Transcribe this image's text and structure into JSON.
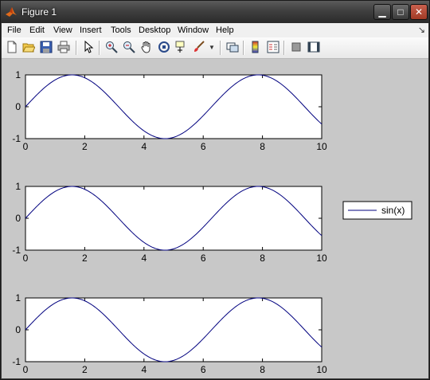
{
  "window": {
    "title": "Figure 1",
    "minimize": "▁",
    "maximize": "□",
    "close": "✕"
  },
  "menu": {
    "items": [
      "File",
      "Edit",
      "View",
      "Insert",
      "Tools",
      "Desktop",
      "Window",
      "Help"
    ],
    "arrow": "↘"
  },
  "toolbar": {
    "icons": [
      "new-figure-icon",
      "open-file-icon",
      "save-icon",
      "print-icon",
      "edit-plot-arrow-icon",
      "zoom-in-icon",
      "zoom-out-icon",
      "pan-hand-icon",
      "rotate-3d-icon",
      "data-cursor-icon",
      "brush-icon",
      "brush-dropdown-icon",
      "link-plot-icon",
      "insert-colorbar-icon",
      "insert-legend-icon",
      "hide-plot-tools-icon",
      "show-plot-tools-icon"
    ]
  },
  "colors": {
    "line": "#00007f",
    "axes_bg": "#ffffff",
    "figure_bg": "#c8c8c8"
  },
  "chart_data": [
    {
      "type": "line",
      "x_range": [
        0,
        10
      ],
      "ylim": [
        -1,
        1
      ],
      "xticks": [
        "0",
        "2",
        "4",
        "6",
        "8",
        "10"
      ],
      "yticks": [
        "1",
        "0",
        "-1"
      ],
      "function": "sin(x)",
      "series": [
        {
          "values_expr": "sin(x)"
        }
      ]
    },
    {
      "type": "line",
      "x_range": [
        0,
        10
      ],
      "ylim": [
        -1,
        1
      ],
      "xticks": [
        "0",
        "2",
        "4",
        "6",
        "8",
        "10"
      ],
      "yticks": [
        "1",
        "0",
        "-1"
      ],
      "function": "sin(x)",
      "series": [
        {
          "name": "sin(x)",
          "values_expr": "sin(x)"
        }
      ],
      "legend": {
        "entries": [
          "sin(x)"
        ],
        "placement": "outside-right"
      }
    },
    {
      "type": "line",
      "x_range": [
        0,
        10
      ],
      "ylim": [
        -1,
        1
      ],
      "xticks": [
        "0",
        "2",
        "4",
        "6",
        "8",
        "10"
      ],
      "yticks": [
        "1",
        "0",
        "-1"
      ],
      "function": "sin(x)",
      "series": [
        {
          "values_expr": "sin(x)"
        }
      ]
    }
  ]
}
